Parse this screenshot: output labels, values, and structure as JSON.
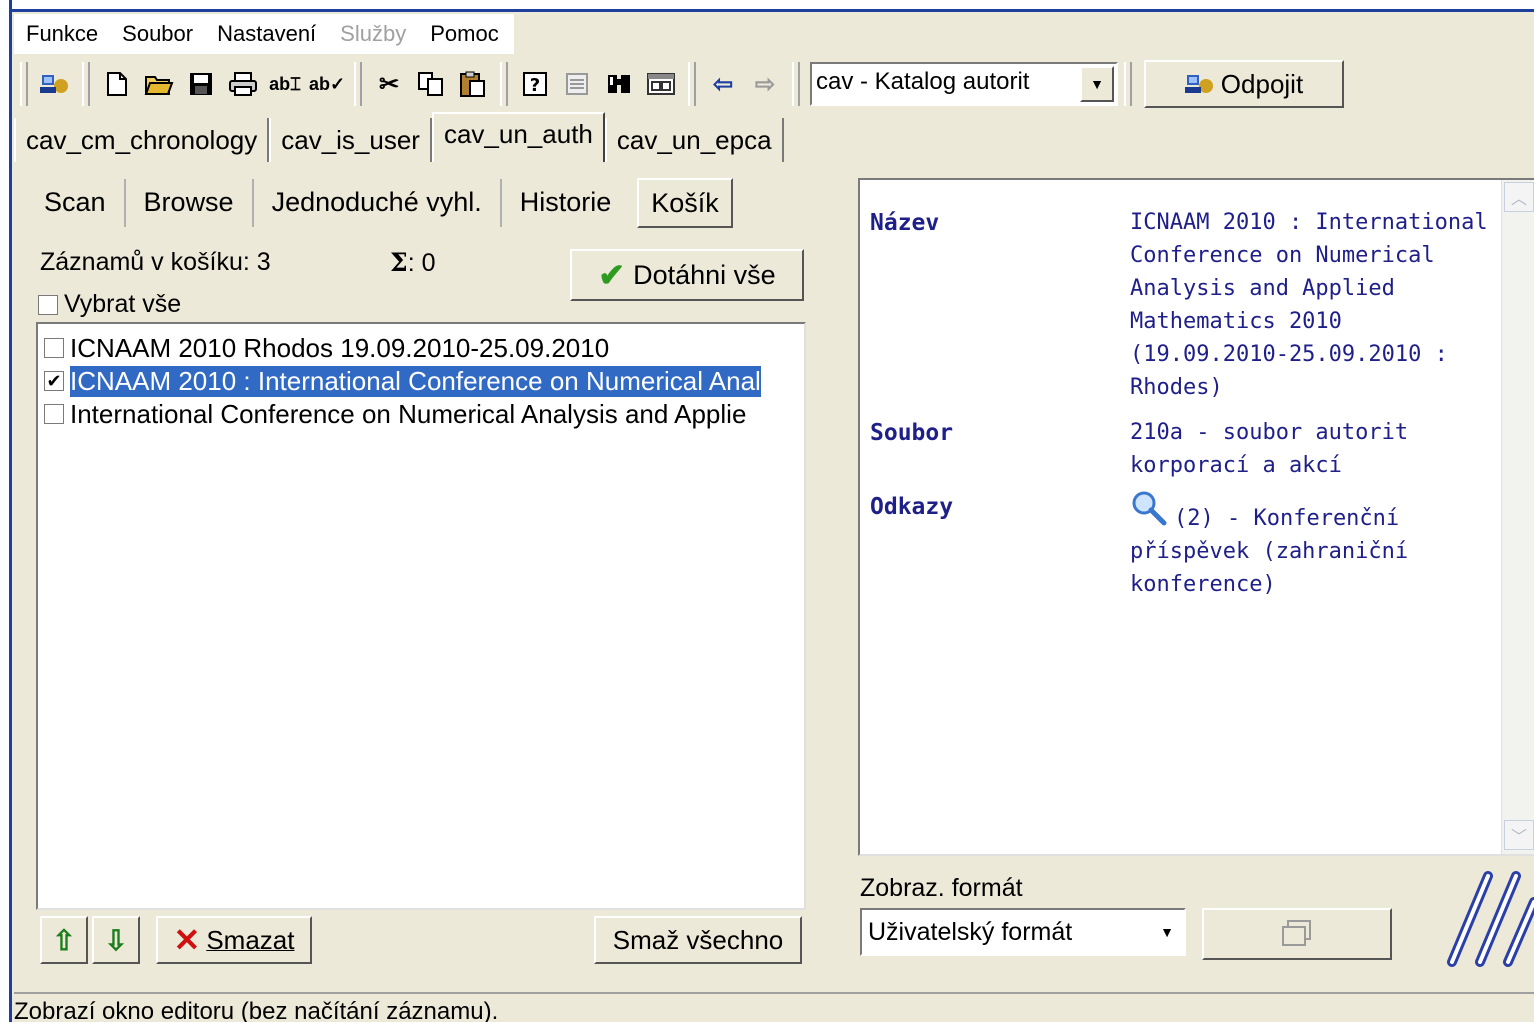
{
  "menu": [
    "Funkce",
    "Soubor",
    "Nastavení",
    "Služby",
    "Pomoc"
  ],
  "toolbar": {
    "database_select": "cav - Katalog autorit",
    "disconnect_label": "Odpojit"
  },
  "db_tabs": [
    "cav_cm_chronology",
    "cav_is_user",
    "cav_un_auth",
    "cav_un_epca"
  ],
  "panel_tabs": [
    "Scan",
    "Browse",
    "Jednoduché vyhl.",
    "Historie",
    "Košík"
  ],
  "basket": {
    "count_label": "Záznamů v košíku: 3",
    "sigma_symbol": "Σ",
    "sigma_value": ": 0",
    "select_all": "Vybrat vše",
    "fetch_all": "Dotáhni vše",
    "items": [
      {
        "text": "ICNAAM 2010 Rhodos 19.09.2010-25.09.2010",
        "checked": false,
        "selected": false
      },
      {
        "text": "ICNAAM 2010 : International Conference on Numerical Anal",
        "checked": true,
        "selected": true
      },
      {
        "text": "International Conference on Numerical Analysis and Applie",
        "checked": false,
        "selected": false
      }
    ],
    "up_arrow": "⇧",
    "down_arrow": "⇩",
    "delete_label": "Smazat",
    "delete_all_label": "Smaž všechno"
  },
  "detail": {
    "fields": [
      {
        "label": "Název",
        "value": "ICNAAM 2010 : International Conference on Numerical Analysis and Applied Mathematics 2010 (19.09.2010-25.09.2010 : Rhodes)"
      },
      {
        "label": "Soubor",
        "value": "210a - soubor autorit korporací a akcí"
      },
      {
        "label": "Odkazy",
        "value": "(2) - Konferenční příspěvek (zahraniční konference)"
      }
    ]
  },
  "format": {
    "label": "Zobraz. formát",
    "selected": "Uživatelský formát"
  },
  "status_text": "Zobrazí okno editoru (bez načítání záznamu).",
  "colors": {
    "accent": "#316ac5",
    "detail_text": "#1f1f8a",
    "window_bg": "#ece9d8"
  }
}
